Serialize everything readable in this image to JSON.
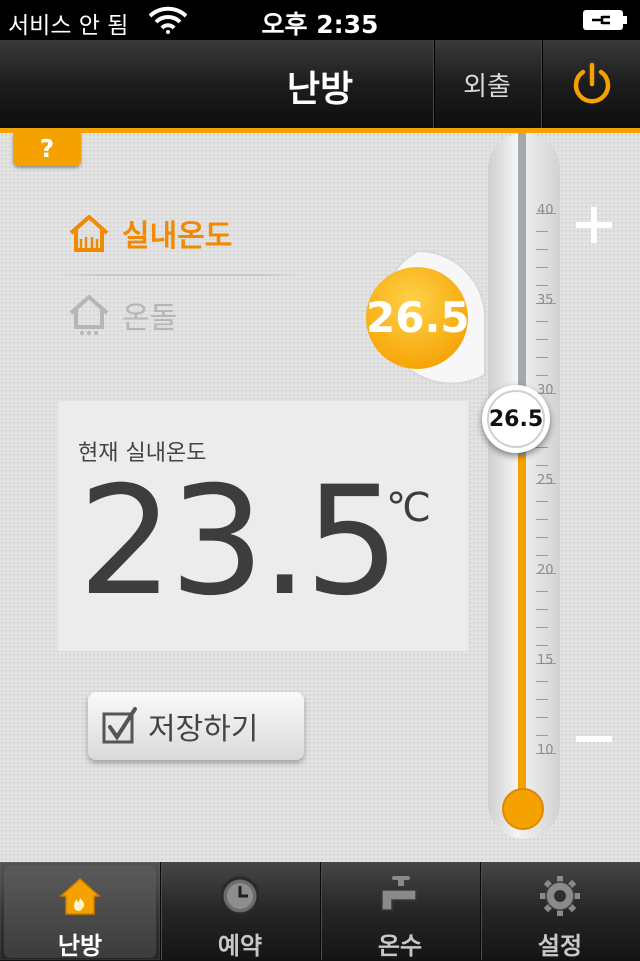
{
  "statusbar": {
    "carrier": "서비스 안 됨",
    "time": "오후 2:35"
  },
  "navbar": {
    "title": "난방",
    "away_label": "외출"
  },
  "help": {
    "label": "?"
  },
  "modes": {
    "indoor": "실내온도",
    "floor": "온돌"
  },
  "current": {
    "label": "현재 실내온도",
    "value": "23.5",
    "unit": "℃"
  },
  "setpoint": {
    "value": "26.5",
    "knob_value": "26.5"
  },
  "save": {
    "label": "저장하기"
  },
  "scale": {
    "ticks": [
      "40",
      "35",
      "30",
      "25",
      "20",
      "15",
      "10"
    ],
    "min": 10,
    "max": 40,
    "fill_to": 26.5
  },
  "tabs": [
    {
      "label": "난방"
    },
    {
      "label": "예약"
    },
    {
      "label": "온수"
    },
    {
      "label": "설정"
    }
  ],
  "colors": {
    "accent": "#f5a100",
    "accent_text": "#f08a00"
  }
}
